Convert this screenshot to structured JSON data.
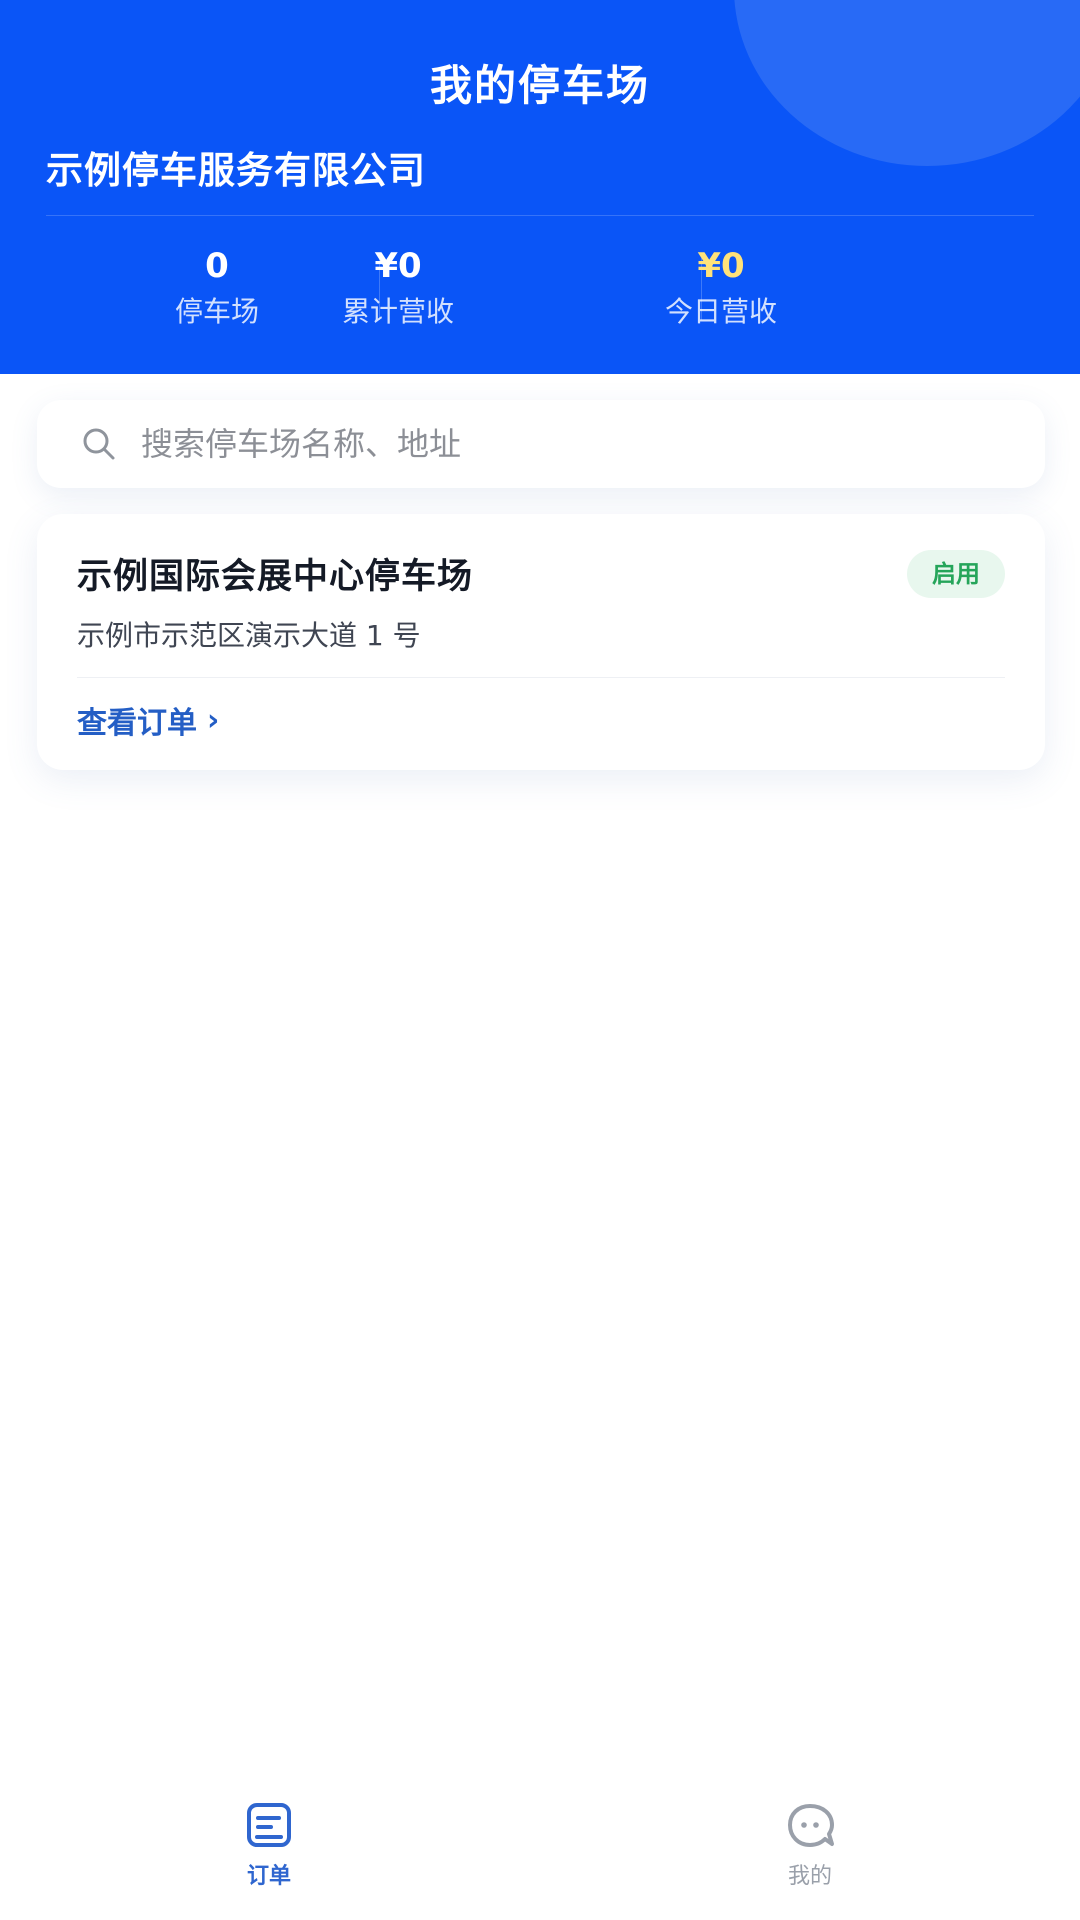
{
  "header": {
    "title": "我的停车场",
    "company": "示例停车服务有限公司",
    "stats": [
      {
        "value": "0",
        "label": "停车场"
      },
      {
        "value": "¥0",
        "label": "累计营收"
      },
      {
        "value": "¥0",
        "label": "今日营收"
      }
    ],
    "accent_color": "#0a55f7",
    "today_revenue_color": "#ffe27a"
  },
  "search": {
    "placeholder": "搜索停车场名称、地址",
    "value": "",
    "icon": "search-icon"
  },
  "lots": [
    {
      "name": "示例国际会展中心停车场",
      "status": "启用",
      "status_color": "#25a55a",
      "address": "示例市示范区演示大道 1 号",
      "action_label": "查看订单",
      "action_icon": "chevron-right-icon"
    }
  ],
  "tabbar": {
    "items": [
      {
        "label": "订单",
        "icon": "orders-icon",
        "active": true,
        "color": "#2f66cf"
      },
      {
        "label": "我的",
        "icon": "profile-icon",
        "active": false,
        "color": "#9aa0aa"
      }
    ]
  }
}
